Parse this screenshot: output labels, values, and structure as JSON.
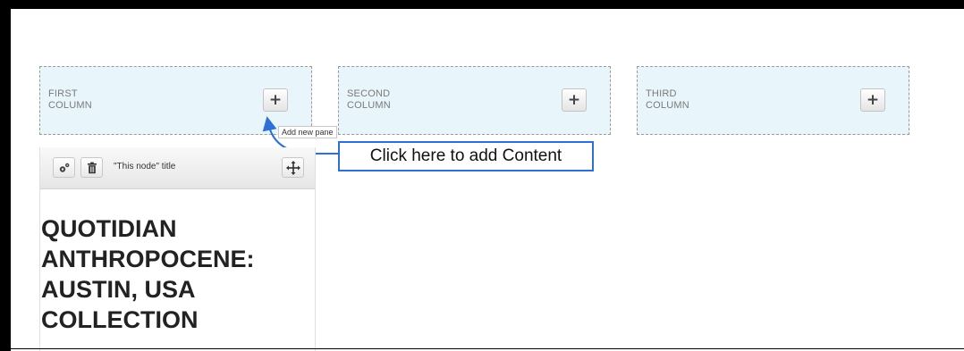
{
  "columns": [
    {
      "label": "FIRST\nCOLUMN",
      "button": "+"
    },
    {
      "label": "SECOND\nCOLUMN",
      "button": "+"
    },
    {
      "label": "THIRD\nCOLUMN",
      "button": "+"
    }
  ],
  "tooltip": "Add new pane",
  "callout": "Click here to add Content",
  "pane": {
    "title": "\"This node\" title",
    "heading": "QUOTIDIAN\nANTHROPOCENE:\nAUSTIN, USA\nCOLLECTION"
  },
  "colors": {
    "region_bg": "#e8f6fb",
    "callout_border": "#2f6fd8"
  }
}
